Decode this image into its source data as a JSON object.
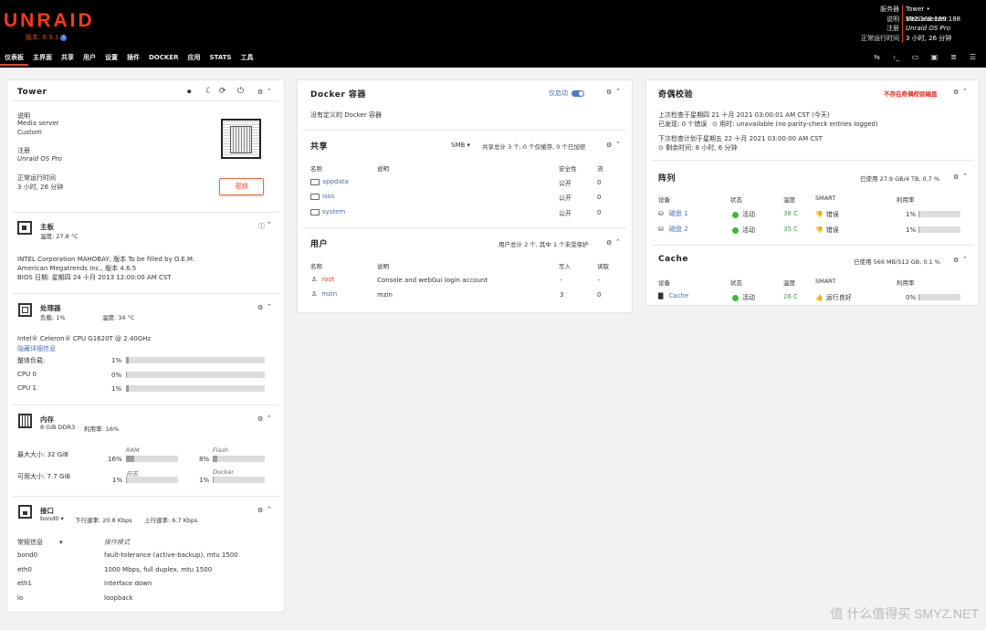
{
  "header": {
    "logo": "UNRAID",
    "version": "版本: 6.9.1",
    "version_info_icon": "info-icon",
    "sysinfo": [
      {
        "k": "服务器",
        "v": "Tower • 192.168.199.188"
      },
      {
        "k": "说明",
        "v": "Media server"
      },
      {
        "k": "注册",
        "v": "Unraid OS Pro"
      },
      {
        "k": "正常运行时间",
        "v": "3 小时, 26 分钟"
      }
    ],
    "tabs": [
      "仪表板",
      "主界面",
      "共享",
      "用户",
      "设置",
      "插件",
      "DOCKER",
      "应用",
      "STATS",
      "工具"
    ],
    "right_icons": [
      "terminal-icon",
      "console-icon",
      "feedback-icon",
      "display-icon",
      "log-icon",
      "menu-icon"
    ]
  },
  "col1": {
    "tower": {
      "title": "Tower",
      "desc_label": "说明",
      "desc_1": "Media server",
      "desc_2": "Custom",
      "reg_label": "注册",
      "reg_value": "Unraid OS Pro",
      "uptime_label": "正常运行时间",
      "uptime_value": "3 小时, 26 分钟",
      "license_button": "密钥"
    },
    "mb": {
      "title": "主板",
      "temp": "温度: 27.8 °C",
      "line1": "INTEL Corporation MAHOBAY, 版本 To be filled by O.E.M.",
      "line2": "American Megatrends Inc., 版本 4.6.5",
      "line3": "BIOS 日期: 星期四 24 十月 2013 12:00:00 AM CST"
    },
    "cpu": {
      "title": "处理器",
      "load": "负载: 1%",
      "temp": "温度: 34 °C",
      "model": "Intel® Celeron® CPU G1620T @ 2.40GHz",
      "hide_link": "隐藏详细信息",
      "rows": [
        {
          "label": "整体负载:",
          "value": "1%",
          "frac": 0.01
        },
        {
          "label": "CPU 0",
          "value": "0%",
          "frac": 0.0
        },
        {
          "label": "CPU 1",
          "value": "1%",
          "frac": 0.01
        }
      ]
    },
    "mem": {
      "title": "内存",
      "spec": "8 GiB DDR3",
      "usage": "利用率: 16%",
      "max_label": "最大大小: 32 GiB",
      "avail_label": "可用大小: 7.7 GiB",
      "bars": [
        {
          "name": "RAM",
          "value": "16%",
          "frac": 0.16
        },
        {
          "name": "Flash",
          "value": "8%",
          "frac": 0.08
        },
        {
          "name": "日志",
          "value": "1%",
          "frac": 0.01
        },
        {
          "name": "Docker",
          "value": "1%",
          "frac": 0.01
        }
      ]
    },
    "net": {
      "title": "接口",
      "iface": "bond0",
      "dropdown": "bond0",
      "down": "下行速率: 20.8 Kbps",
      "up": "上行速率: 6.7 Kbps",
      "info_select": "常规信息",
      "mode_label": "操作模式",
      "rows": [
        {
          "n": "bond0",
          "v": "fault-tolerance (active-backup), mtu 1500"
        },
        {
          "n": "eth0",
          "v": "1000 Mbps, full duplex, mtu 1500"
        },
        {
          "n": "eth1",
          "v": "interface down"
        },
        {
          "n": "lo",
          "v": "loopback"
        }
      ]
    }
  },
  "col2": {
    "docker": {
      "title": "Docker 容器",
      "only_started": "仅启动",
      "empty": "没有定义的 Docker 容器"
    },
    "shares": {
      "title": "共享",
      "proto": "SMB",
      "summary": "共享总计 3 个, 0 个仅缓存, 0 个已加密",
      "cols": [
        "名称",
        "说明",
        "安全性",
        "流"
      ],
      "rows": [
        {
          "name": "appdata",
          "desc": "",
          "sec": "公开",
          "stream": "0"
        },
        {
          "name": "isos",
          "desc": "",
          "sec": "公开",
          "stream": "0"
        },
        {
          "name": "system",
          "desc": "",
          "sec": "公开",
          "stream": "0"
        }
      ]
    },
    "users": {
      "title": "用户",
      "summary": "用户总计 2 个, 其中 1 个未受保护",
      "cols": [
        "名称",
        "说明",
        "写入",
        "读取"
      ],
      "rows": [
        {
          "name": "root",
          "desc": "Console and webGui login account",
          "w": "-",
          "r": "-"
        },
        {
          "name": "mzin",
          "desc": "mzin",
          "w": "3",
          "r": "0"
        }
      ]
    }
  },
  "col3": {
    "parity": {
      "title": "奇偶校验",
      "warning": "不存在奇偶校验磁盘",
      "last_check": "上次检查于星期四 21 十月 2021 03:00:01 AM CST (今天)",
      "found": "已发现: 0 个错误",
      "elapsed": "用时: unavailable (no parity-check entries logged)",
      "next_check": "下次检查计划于星期五 22 十月 2021 03:00:00 AM CST",
      "remaining": "剩余时间: 8 小时, 6 分钟"
    },
    "array": {
      "title": "阵列",
      "usage": "已使用 27.9 GB/4 TB, 0.7 %",
      "cols": [
        "设备",
        "状态",
        "温度",
        "SMART",
        "利用率"
      ],
      "rows": [
        {
          "dev": "磁盘 1",
          "state": "活动",
          "temp": "38 C",
          "smart": "错误",
          "util": "1%",
          "frac": 0.01
        },
        {
          "dev": "磁盘 2",
          "state": "活动",
          "temp": "35 C",
          "smart": "错误",
          "util": "1%",
          "frac": 0.01
        }
      ]
    },
    "cache": {
      "title": "Cache",
      "usage": "已使用 566 MB/512 GB, 0.1 %",
      "cols": [
        "设备",
        "状态",
        "温度",
        "SMART",
        "利用率"
      ],
      "rows": [
        {
          "dev": "Cache",
          "state": "活动",
          "temp": "26 C",
          "smart": "运行良好",
          "util": "0%",
          "frac": 0.0
        }
      ]
    }
  },
  "watermark": "值 什么值得买 SMYZ.NET"
}
